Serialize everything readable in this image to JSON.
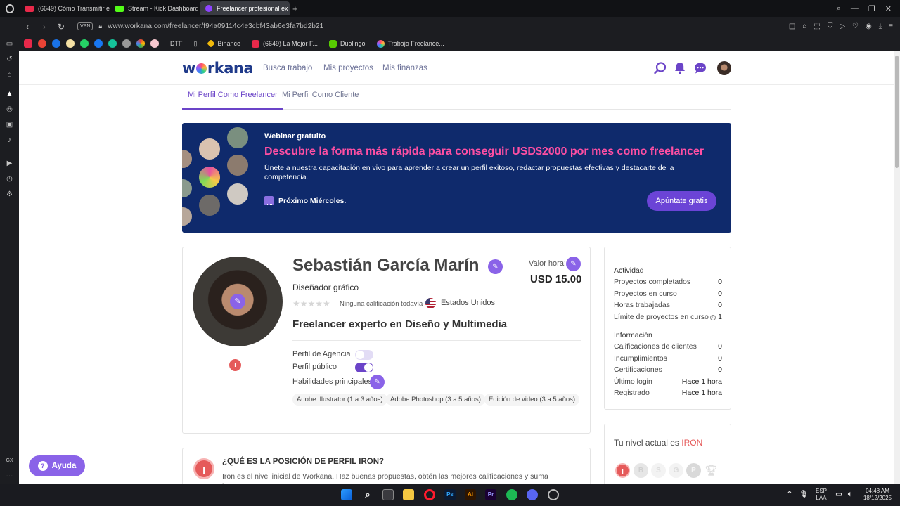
{
  "browser": {
    "tabs": [
      {
        "label": "(6649) Cómo Transmitir e",
        "color": "#e8294a",
        "active": false
      },
      {
        "label": "Stream - Kick Dashboard",
        "color": "#53fc18",
        "active": false
      },
      {
        "label": "Freelancer profesional ex",
        "color": "#8e44ff",
        "active": true
      }
    ],
    "new_tab": "+",
    "vpn": "VPN",
    "url": "www.workana.com/freelancer/f94a09114c4e3cbf43ab6e3fa7bd2b21",
    "bookmarks": [
      {
        "label": "DTF",
        "color": "#bbbbbb"
      },
      {
        "label": "Binance",
        "color": "#f0b90b"
      },
      {
        "label": "(6649) La Mejor F...",
        "color": "#e8294a"
      },
      {
        "label": "Duolingo",
        "color": "#58cc02"
      },
      {
        "label": "Trabajo Freelance...",
        "color": "#8e44ff"
      }
    ]
  },
  "nav": {
    "logo": [
      "w",
      "rkana"
    ],
    "links": [
      "Busca trabajo",
      "Mis proyectos",
      "Mis finanzas"
    ]
  },
  "subtabs": {
    "freelancer": "Mi Perfil Como Freelancer",
    "client": "Mi Perfil Como Cliente"
  },
  "banner": {
    "kicker": "Webinar gratuito",
    "title": "Descubre la forma más rápida para conseguir USD$2000 por mes como freelancer",
    "description": "Únete a nuestra capacitación en vivo para aprender a crear un perfil exitoso, redactar propuestas efectivas y destacarte de la competencia.",
    "date": "Próximo Miércoles.",
    "cta": "Apúntate gratis"
  },
  "profile": {
    "name": "Sebastián García Marín",
    "role": "Diseñador gráfico",
    "stars": "★★★★★",
    "rating_text": "Ninguna calificación todavía",
    "country": "Estados Unidos",
    "headline": "Freelancer experto en Diseño y Multimedia",
    "rate_label": "Valor hora:",
    "rate_value": "USD 15.00",
    "agency_label": "Perfil de Agencia",
    "public_label": "Perfil público",
    "skills_label": "Habilidades principales",
    "level_badge": "I",
    "skills": [
      "Adobe Illustrator (1 a 3 años)",
      "Adobe Photoshop (3 a 5 años)",
      "Edición de video (3 a 5 años)"
    ]
  },
  "stats": {
    "activity_title": "Actividad",
    "activity": [
      {
        "label": "Proyectos completados",
        "value": "0"
      },
      {
        "label": "Proyectos en curso",
        "value": "0"
      },
      {
        "label": "Horas trabajadas",
        "value": "0"
      },
      {
        "label": "Límite de proyectos en curso",
        "value": "1"
      }
    ],
    "info_title": "Información",
    "info": [
      {
        "label": "Calificaciones de clientes",
        "value": "0"
      },
      {
        "label": "Incumplimientos",
        "value": "0"
      },
      {
        "label": "Certificaciones",
        "value": "0"
      },
      {
        "label": "Último login",
        "value": "Hace 1 hora"
      },
      {
        "label": "Registrado",
        "value": "Hace 1 hora"
      }
    ]
  },
  "level": {
    "title_prefix": "Tu nivel actual es",
    "title_level": "IRON",
    "badges": [
      "I",
      "B",
      "S",
      "G",
      "P"
    ]
  },
  "iron_section": {
    "badge": "I",
    "question": "¿QUÉ ES LA POSICIÓN DE PERFIL IRON?",
    "description": "Iron es el nivel inicial de Workana. Haz buenas propuestas, obtén las mejores calificaciones y suma ingresos"
  },
  "help": {
    "label": "Ayuda",
    "icon": "?"
  },
  "taskbar": {
    "apps": [
      "Ps",
      "Ai",
      "Pr"
    ],
    "lang": "ESP",
    "lang_sub": "LAA",
    "time": "04:48 AM",
    "date": "18/12/2025"
  },
  "colors": {
    "brand": "#6b44c8",
    "banner_bg": "#0f2a6c",
    "banner_title": "#ff4fa3",
    "iron": "#e55a5a"
  }
}
